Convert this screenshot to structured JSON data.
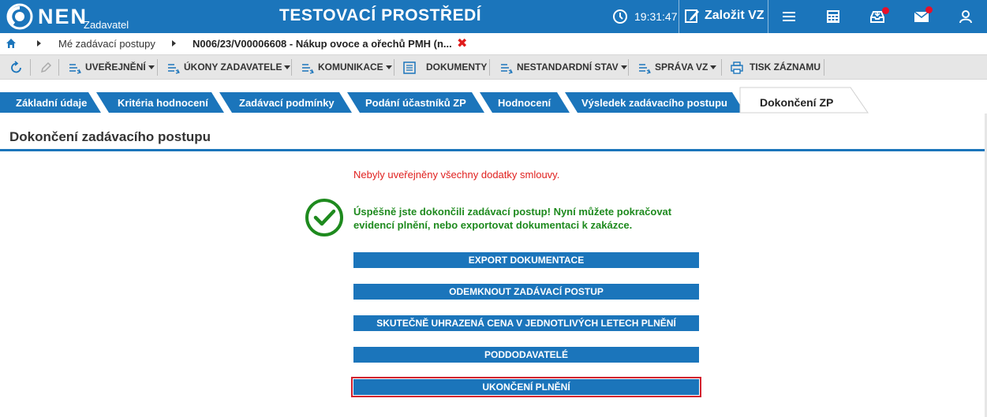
{
  "header": {
    "logo_text": "NEN",
    "logo_sub": "Zadavatel",
    "environment_title": "TESTOVACÍ PROSTŘEDÍ",
    "clock": "19:31:47",
    "create_label": "Založit VZ",
    "icons": [
      "menu-icon",
      "calculator-icon",
      "inbox-icon",
      "mail-icon",
      "user-icon"
    ],
    "badge_color": "#e8102a"
  },
  "breadcrumb": {
    "items": [
      "Mé zadávací postupy",
      "N006/23/V00006608 - Nákup ovoce a ořechů PMH (n..."
    ],
    "close_glyph": "✖"
  },
  "toolbar": {
    "items": [
      {
        "label": "UVEŘEJNĚNÍ",
        "dropdown": true
      },
      {
        "label": "ÚKONY ZADAVATELE",
        "dropdown": true
      },
      {
        "label": "KOMUNIKACE",
        "dropdown": true
      },
      {
        "label": "DOKUMENTY",
        "dropdown": false
      },
      {
        "label": "NESTANDARDNÍ STAV",
        "dropdown": true
      },
      {
        "label": "SPRÁVA VZ",
        "dropdown": true
      },
      {
        "label": "TISK ZÁZNAMU",
        "dropdown": false
      }
    ]
  },
  "tabs": [
    {
      "label": "Základní údaje",
      "active": false
    },
    {
      "label": "Kritéria hodnocení",
      "active": false
    },
    {
      "label": "Zadávací podmínky",
      "active": false
    },
    {
      "label": "Podání účastníků ZP",
      "active": false
    },
    {
      "label": "Hodnocení",
      "active": false
    },
    {
      "label": "Výsledek zadávacího postupu",
      "active": false
    },
    {
      "label": "Dokončení ZP",
      "active": true
    }
  ],
  "panel": {
    "title": "Dokončení zadávacího postupu",
    "warning": "Nebyly uveřejněny všechny dodatky smlouvy.",
    "success": "Úspěšně jste dokončili zadávací postup! Nyní můžete pokračovat evidencí plnění, nebo exportovat dokumentaci k zakázce.",
    "buttons": [
      "EXPORT DOKUMENTACE",
      "ODEMKNOUT ZADÁVACÍ POSTUP",
      "SKUTEČNĚ UHRAZENÁ CENA V JEDNOTLIVÝCH LETECH PLNĚNÍ",
      "PODDODAVATELÉ",
      "UKONČENÍ PLNĚNÍ"
    ]
  },
  "colors": {
    "brand": "#1b75bb",
    "warning": "#e0211f",
    "success": "#1e8a1e",
    "highlight": "#d2202e"
  }
}
